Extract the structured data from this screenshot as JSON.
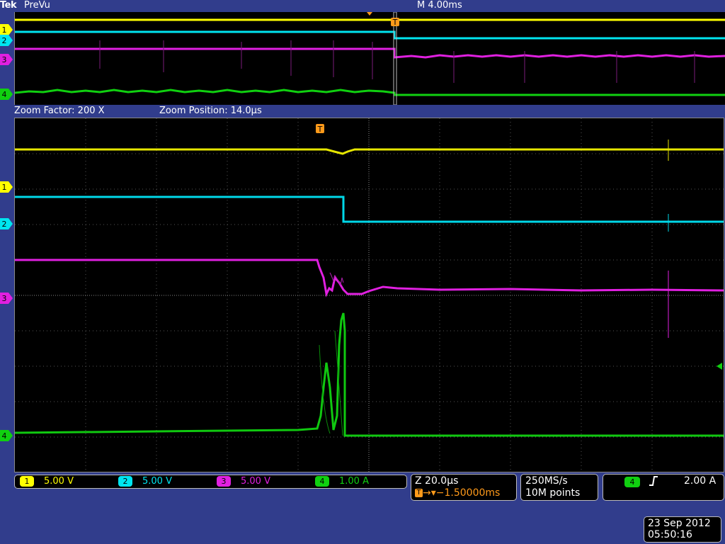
{
  "header": {
    "logo": "Tek",
    "mode": "PreVu",
    "timebase": "M 4.00ms"
  },
  "zoom_info": {
    "factor": "Zoom Factor: 200 X",
    "position": "Zoom Position: 14.0µs"
  },
  "channel_markers": [
    "1",
    "2",
    "3",
    "4"
  ],
  "trigger_marker": "T",
  "channels": [
    {
      "id": "1",
      "scale": "5.00 V",
      "color": "#ffff00"
    },
    {
      "id": "2",
      "scale": "5.00 V",
      "color": "#00e5f0"
    },
    {
      "id": "3",
      "scale": "5.00 V",
      "color": "#e020e0"
    },
    {
      "id": "4",
      "scale": "1.00 A",
      "color": "#10d010"
    }
  ],
  "zoom_box": {
    "scale": "Z 20.0µs",
    "trigger_pos": "−1.50000ms"
  },
  "acquisition": {
    "rate": "250MS/s",
    "points": "10M points"
  },
  "trigger": {
    "source": "4",
    "slope_icon": "rising-edge",
    "level": "2.00 A"
  },
  "datetime": {
    "date": "23 Sep 2012",
    "time": "05:50:16"
  },
  "colors": {
    "background": "#313d8c",
    "trigger": "#ff9a1a"
  }
}
